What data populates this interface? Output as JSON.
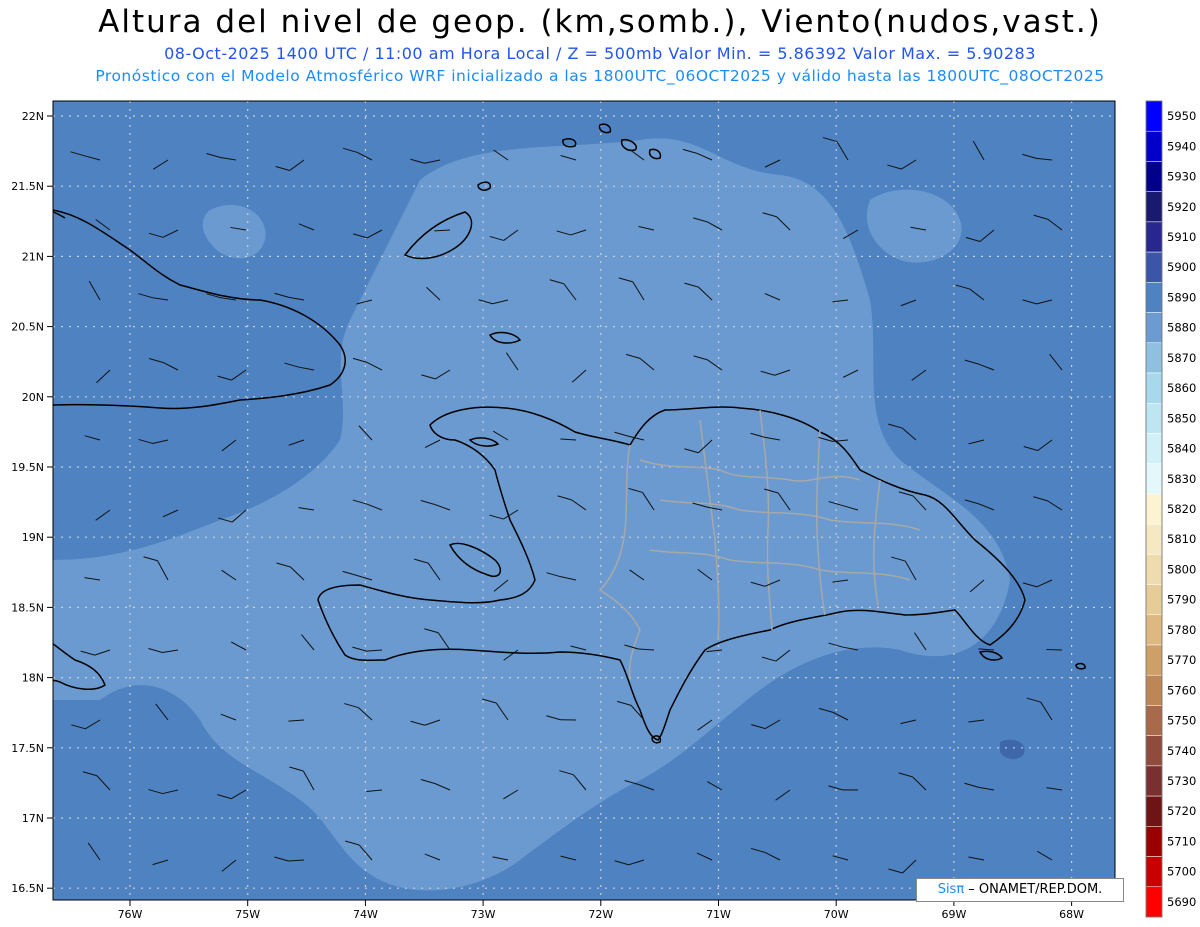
{
  "header": {
    "title": "Altura del nivel de geop. (km,somb.), Viento(nudos,vast.)",
    "subtitle1": "08-Oct-2025  1400 UTC / 11:00 am Hora Local / Z = 500mb    Valor Min. = 5.86392  Valor Max. = 5.90283",
    "subtitle2": "Pronóstico con el Modelo Atmosférico WRF inicializado a las 1800UTC_06OCT2025 y válido hasta las  1800UTC_08OCT2025"
  },
  "map": {
    "lat_labels": [
      "22N",
      "21.5N",
      "21N",
      "20.5N",
      "20N",
      "19.5N",
      "19N",
      "18.5N",
      "18N",
      "17.5N",
      "17N",
      "16.5N"
    ],
    "lon_labels": [
      "76W",
      "75W",
      "74W",
      "73W",
      "72W",
      "71W",
      "70W",
      "69W",
      "68W"
    ],
    "background_color": "#4f82c0",
    "light_region_color": "#6b9bd0",
    "coast_color": "#000000",
    "province_border_color": "#a8a8a8",
    "grid": true
  },
  "colorbar": {
    "levels": [
      "5950",
      "5940",
      "5930",
      "5920",
      "5910",
      "5900",
      "5890",
      "5880",
      "5870",
      "5860",
      "5850",
      "5840",
      "5830",
      "5820",
      "5810",
      "5800",
      "5790",
      "5780",
      "5770",
      "5760",
      "5750",
      "5740",
      "5730",
      "5720",
      "5710",
      "5700",
      "5690"
    ],
    "colors": [
      "#0000ff",
      "#0000c8",
      "#00008b",
      "#191970",
      "#27278f",
      "#3b55a8",
      "#4f82c0",
      "#6b9bd0",
      "#90c0e0",
      "#a8d8ec",
      "#bde6f2",
      "#d2f0f8",
      "#e4f8fc",
      "#fbf3d2",
      "#f5e8c2",
      "#eedcae",
      "#e6cc96",
      "#ddb880",
      "#cea068",
      "#bd8656",
      "#a86a4a",
      "#8f4c3c",
      "#7a3030",
      "#6e1414",
      "#9a0000",
      "#c80000",
      "#ff0000"
    ]
  },
  "credit": {
    "brand": "Sisπ",
    "text": " – ONAMET/REP.DOM."
  }
}
